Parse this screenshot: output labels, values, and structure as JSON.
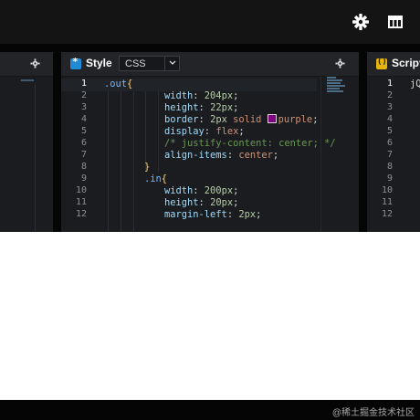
{
  "toolbar": {
    "settings_icon": "gear-icon",
    "layout_icon": "layout-grid-icon"
  },
  "left_panel": {
    "settings_icon": "gear-icon"
  },
  "style_panel": {
    "title": "Style",
    "icon": "css-icon",
    "language": "CSS",
    "line_numbers": [
      "1",
      "2",
      "3",
      "4",
      "5",
      "6",
      "7",
      "8",
      "9",
      "10",
      "11",
      "12"
    ],
    "code_lines": [
      {
        "selector": ".out",
        "brace": "{"
      },
      {
        "property": "width",
        "value": "204px"
      },
      {
        "property": "height",
        "value": "22px"
      },
      {
        "property": "border",
        "value_num": "2px",
        "value_kw": "solid",
        "color_name": "purple"
      },
      {
        "property": "display",
        "value": "flex"
      },
      {
        "comment": "/* justify-content: center; */"
      },
      {
        "property": "align-items",
        "value": "center"
      },
      {
        "brace": "}"
      },
      {
        "selector": ".in",
        "brace": "{"
      },
      {
        "property": "width",
        "value": "200px"
      },
      {
        "property": "height",
        "value": "20px"
      },
      {
        "property": "margin-left",
        "value": "2px"
      }
    ]
  },
  "script_panel": {
    "title": "Script",
    "icon": "js-icon",
    "line_numbers": [
      "1",
      "2",
      "3",
      "4",
      "5",
      "6",
      "7",
      "8",
      "9",
      "10",
      "11",
      "12"
    ],
    "first_line_snippet": "jQ"
  },
  "footer": {
    "watermark": "@稀土掘金技术社区"
  },
  "colors": {
    "accent_css": "#1f8bd6",
    "accent_js": "#e5b50f",
    "swatch": "#800080"
  }
}
